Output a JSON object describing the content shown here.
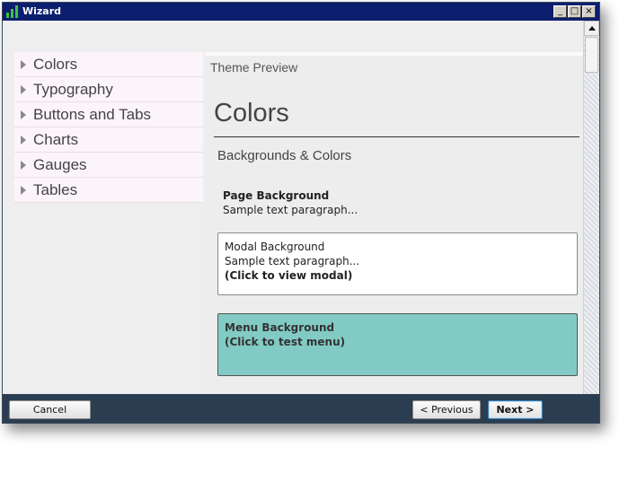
{
  "window": {
    "title": "Wizard",
    "controls": {
      "minimize": "_",
      "maximize": "□",
      "close": "×"
    }
  },
  "sidebar": {
    "items": [
      {
        "label": "Colors"
      },
      {
        "label": "Typography"
      },
      {
        "label": "Buttons and Tabs"
      },
      {
        "label": "Charts"
      },
      {
        "label": "Gauges"
      },
      {
        "label": "Tables"
      }
    ]
  },
  "preview": {
    "header": "Theme Preview",
    "heading": "Colors",
    "subheading": "Backgrounds & Colors",
    "page_background": {
      "title": "Page Background",
      "text": "Sample text paragraph..."
    },
    "modal_background": {
      "title": "Modal Background",
      "text": "Sample text paragraph...",
      "action": "(Click to view modal)",
      "color": "#ffffff"
    },
    "menu_background": {
      "title": "Menu Background",
      "action": "(Click to test menu)",
      "color": "#82cbc4"
    }
  },
  "footer": {
    "cancel_label": "Cancel",
    "previous_label": "< Previous",
    "next_label": "Next >"
  },
  "colors": {
    "titlebar": "#0c1e6e",
    "footer": "#2b3e51",
    "sidebar_item": "#fcf4fb",
    "menu_bg": "#82cbc4"
  },
  "icons": [
    "wizard-app-icon",
    "minimize-icon",
    "maximize-icon",
    "close-icon",
    "expand-triangle-icon",
    "scroll-up-arrow-icon"
  ]
}
